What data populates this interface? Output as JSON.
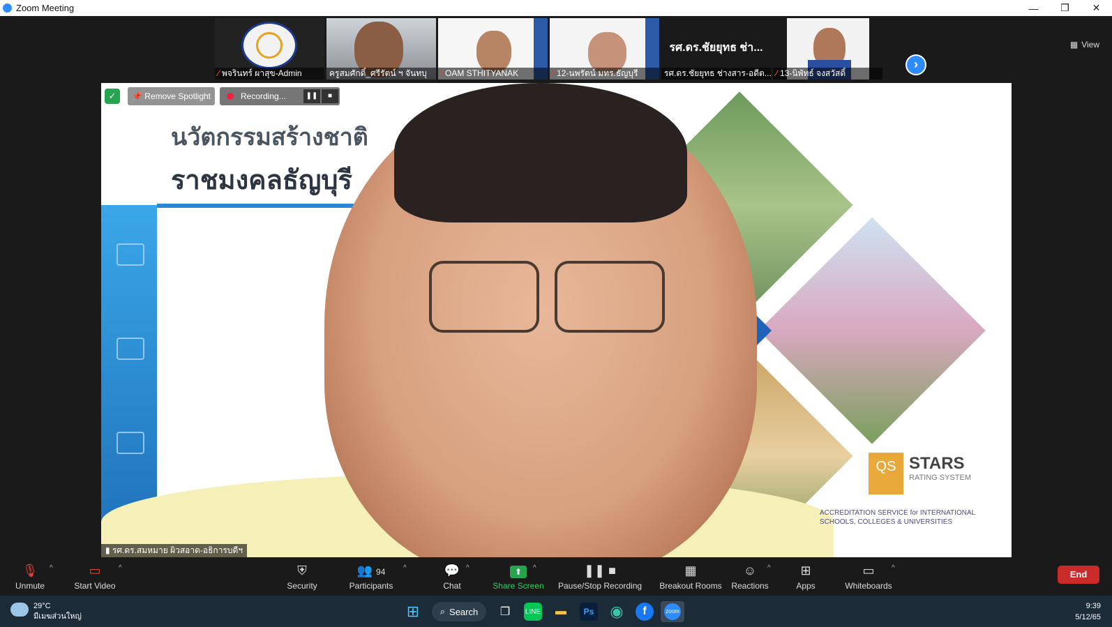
{
  "window": {
    "title": "Zoom Meeting",
    "controls": [
      "—",
      "❐",
      "✕"
    ]
  },
  "gallery": {
    "view_label": "View",
    "tiles": [
      {
        "name": "พจรินทร์ ผาสุข-Admin",
        "muted": true,
        "kind": "logo"
      },
      {
        "name": "ครูสมศักดิ์_ศรีรัตน์ ฯ จันทบุ",
        "muted": false,
        "kind": "video"
      },
      {
        "name": "OAM STHITYANAK",
        "muted": true,
        "kind": "video"
      },
      {
        "name": "12-นพรัตน์ มทร.ธัญบุรี",
        "muted": true,
        "kind": "video"
      },
      {
        "name": "รศ.ดร.ชัยยุทธ ช่างสาร-อดีต...",
        "muted": false,
        "kind": "text",
        "big": "รศ.ดร.ชัยยุทธ ช่า..."
      },
      {
        "name": "13-นิพัทธ์ จงสวัสดิ์",
        "muted": true,
        "kind": "video"
      }
    ]
  },
  "main": {
    "spotlight_label": "Remove Spotlight",
    "recording_label": "Recording...",
    "slide_title_1": "นวัตกรรมสร้างชาติ",
    "slide_title_2": "ราชมงคลธัญบุรี",
    "speaker_name": "รศ.ดร.สมหมาย ผิวสอาด-อธิการบดีฯ",
    "qs_stars": "STARS",
    "qs_rating": "RATING SYSTEM",
    "asic_text": "ACCREDITATION SERVICE for INTERNATIONAL SCHOOLS, COLLEGES & UNIVERSITIES"
  },
  "toolbar": {
    "unmute": "Unmute",
    "start_video": "Start Video",
    "security": "Security",
    "participants": "Participants",
    "participants_count": "94",
    "chat": "Chat",
    "share_screen": "Share Screen",
    "pause_stop": "Pause/Stop Recording",
    "breakout": "Breakout Rooms",
    "reactions": "Reactions",
    "apps": "Apps",
    "whiteboards": "Whiteboards",
    "end": "End"
  },
  "taskbar": {
    "temp": "29°C",
    "weather_desc": "มีเมฆส่วนใหญ่",
    "search": "Search",
    "time": "9:39",
    "date": "5/12/65"
  },
  "colors": {
    "accent": "#2d8cff",
    "end": "#c92a2a",
    "share": "#26a44f"
  }
}
